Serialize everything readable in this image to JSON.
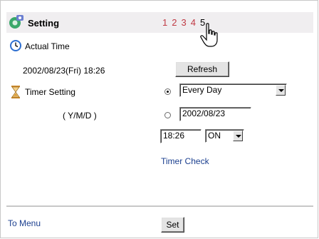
{
  "header": {
    "title": "Setting",
    "pages": [
      "1",
      "2",
      "3",
      "4",
      "5"
    ],
    "current_page": "5"
  },
  "actual_time": {
    "label": "Actual Time",
    "value": "2002/08/23(Fri) 18:26",
    "refresh_label": "Refresh"
  },
  "timer": {
    "label": "Timer Setting",
    "date_format": "( Y/M/D )",
    "repeat_option": "Every Day",
    "date_value": "2002/08/23",
    "time_value": "18:26",
    "state_option": "ON",
    "check_link": "Timer Check"
  },
  "footer": {
    "menu_link": "To Menu",
    "set_label": "Set"
  },
  "icons": {
    "header": "setting-gear-icon",
    "clock": "clock-icon",
    "hourglass": "hourglass-icon",
    "pointer": "hand-pointer-icon"
  },
  "colors": {
    "page_link": "#c03a44",
    "link": "#1b3f8f",
    "header_bg": "#f0eef0"
  }
}
